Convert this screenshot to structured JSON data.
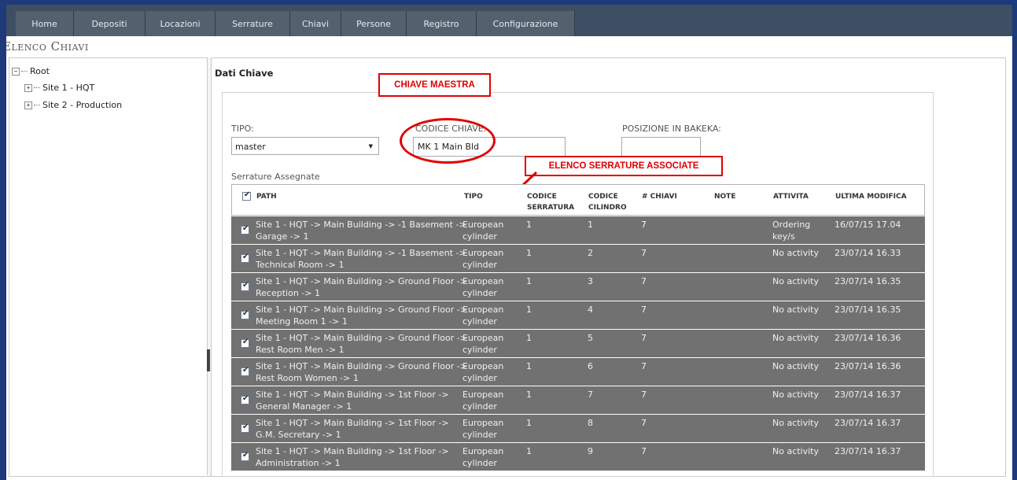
{
  "nav": {
    "tabs": [
      {
        "label": "Home"
      },
      {
        "label": "Depositi"
      },
      {
        "label": "Locazioni"
      },
      {
        "label": "Serrature"
      },
      {
        "label": "Chiavi"
      },
      {
        "label": "Persone"
      },
      {
        "label": "Registro"
      },
      {
        "label": "Configurazione"
      }
    ]
  },
  "page": {
    "title": "Elenco Chiavi"
  },
  "tree": {
    "root": "Root",
    "children": [
      "Site 1 - HQT",
      "Site 2 - Production"
    ]
  },
  "detail": {
    "section_title": "Dati Chiave",
    "tipo_label": "TIPO:",
    "tipo_value": "master",
    "codice_label": "CODICE CHIAVE:",
    "codice_value": "MK 1 Main Bld",
    "posizione_label": "POSIZIONE IN BAKEKA:",
    "posizione_value": "",
    "serrature_heading": "Serrature Assegnate"
  },
  "annotations": {
    "master_key": "CHIAVE MAESTRA",
    "associated_locks": "ELENCO SERRATURE ASSOCIATE",
    "color": "#e10000"
  },
  "grid": {
    "columns": {
      "path": "PATH",
      "tipo": "TIPO",
      "codice_serratura_1": "CODICE",
      "codice_serratura_2": "SERRATURA",
      "codice_cilindro_1": "CODICE",
      "codice_cilindro_2": "CILINDRO",
      "n_chiavi": "# CHIAVI",
      "note": "NOTE",
      "attivita": "ATTIVITA",
      "ultima_modifica": "ULTIMA MODIFICA"
    },
    "rows": [
      {
        "path1": "Site 1 - HQT -> Main Building -> -1 Basement ->",
        "path2": "Garage -> 1",
        "tipo1": "European",
        "tipo2": "cylinder",
        "codice_serratura": "1",
        "codice_cilindro": "1",
        "n_chiavi": "7",
        "note": "",
        "attivita1": "Ordering",
        "attivita2": "key/s",
        "ultima_modifica": "16/07/15 17.04"
      },
      {
        "path1": "Site 1 - HQT -> Main Building -> -1 Basement ->",
        "path2": "Technical Room -> 1",
        "tipo1": "European",
        "tipo2": "cylinder",
        "codice_serratura": "1",
        "codice_cilindro": "2",
        "n_chiavi": "7",
        "note": "",
        "attivita1": "No activity",
        "attivita2": "",
        "ultima_modifica": "23/07/14 16.33"
      },
      {
        "path1": "Site 1 - HQT -> Main Building -> Ground Floor ->",
        "path2": "Reception -> 1",
        "tipo1": "European",
        "tipo2": "cylinder",
        "codice_serratura": "1",
        "codice_cilindro": "3",
        "n_chiavi": "7",
        "note": "",
        "attivita1": "No activity",
        "attivita2": "",
        "ultima_modifica": "23/07/14 16.35"
      },
      {
        "path1": "Site 1 - HQT -> Main Building -> Ground Floor ->",
        "path2": "Meeting Room 1 -> 1",
        "tipo1": "European",
        "tipo2": "cylinder",
        "codice_serratura": "1",
        "codice_cilindro": "4",
        "n_chiavi": "7",
        "note": "",
        "attivita1": "No activity",
        "attivita2": "",
        "ultima_modifica": "23/07/14 16.35"
      },
      {
        "path1": "Site 1 - HQT -> Main Building -> Ground Floor ->",
        "path2": "Rest Room Men -> 1",
        "tipo1": "European",
        "tipo2": "cylinder",
        "codice_serratura": "1",
        "codice_cilindro": "5",
        "n_chiavi": "7",
        "note": "",
        "attivita1": "No activity",
        "attivita2": "",
        "ultima_modifica": "23/07/14 16.36"
      },
      {
        "path1": "Site 1 - HQT -> Main Building -> Ground Floor ->",
        "path2": "Rest Room Women -> 1",
        "tipo1": "European",
        "tipo2": "cylinder",
        "codice_serratura": "1",
        "codice_cilindro": "6",
        "n_chiavi": "7",
        "note": "",
        "attivita1": "No activity",
        "attivita2": "",
        "ultima_modifica": "23/07/14 16.36"
      },
      {
        "path1": "Site 1 - HQT -> Main Building -> 1st Floor ->",
        "path2": "General Manager -> 1",
        "tipo1": "European",
        "tipo2": "cylinder",
        "codice_serratura": "1",
        "codice_cilindro": "7",
        "n_chiavi": "7",
        "note": "",
        "attivita1": "No activity",
        "attivita2": "",
        "ultima_modifica": "23/07/14 16.37"
      },
      {
        "path1": "Site 1 - HQT -> Main Building -> 1st Floor ->",
        "path2": "G.M. Secretary -> 1",
        "tipo1": "European",
        "tipo2": "cylinder",
        "codice_serratura": "1",
        "codice_cilindro": "8",
        "n_chiavi": "7",
        "note": "",
        "attivita1": "No activity",
        "attivita2": "",
        "ultima_modifica": "23/07/14 16.37"
      },
      {
        "path1": "Site 1 - HQT -> Main Building -> 1st Floor ->",
        "path2": "Administration -> 1",
        "tipo1": "European",
        "tipo2": "cylinder",
        "codice_serratura": "1",
        "codice_cilindro": "9",
        "n_chiavi": "7",
        "note": "",
        "attivita1": "No activity",
        "attivita2": "",
        "ultima_modifica": "23/07/14 16.37"
      }
    ]
  }
}
